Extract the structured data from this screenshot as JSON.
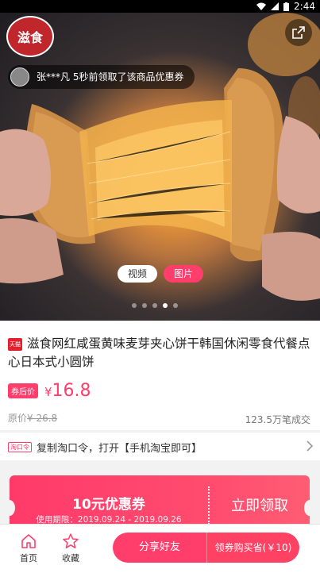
{
  "status_bar": {
    "time": "2:44"
  },
  "hero": {
    "logo_text": "滋食",
    "toast": "张***凡 5秒前领取了该商品优惠券",
    "tabs": {
      "video": "视频",
      "image": "图片"
    }
  },
  "product": {
    "store_badge": "天猫",
    "title": "滋食网红咸蛋黄味麦芽夹心饼干韩国休闲零食代餐点心日本式小圆饼",
    "price_badge": "券后价",
    "currency": "¥",
    "price": "16.8",
    "original_label": "原价",
    "original_price": "¥ 26.8",
    "sales": "123.5万笔成交"
  },
  "tkl": {
    "badge": "淘口令",
    "text": "复制淘口令，打开【手机淘宝即可】"
  },
  "coupon": {
    "amount": "10元优惠券",
    "validity": "使用期限：2019.09.24 - 2019.09.26",
    "claim": "立即领取"
  },
  "bottom_nav": {
    "home": "首页",
    "favorite": "收藏",
    "share": "分享好友",
    "buy": "领券购买省(￥10)"
  },
  "colors": {
    "accent": "#ff3e6c",
    "tmall": "#e4202f"
  }
}
